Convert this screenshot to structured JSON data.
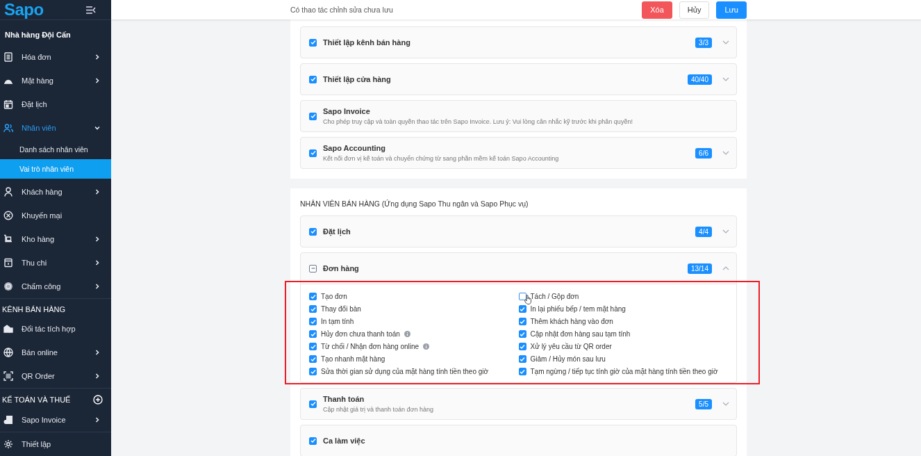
{
  "sidebar": {
    "logo": "Sapo",
    "store": "Nhà hàng Đội Cấn",
    "groups": [
      {
        "items": [
          {
            "label": "Hóa đơn",
            "submenu": true,
            "expanded": false,
            "selected": false
          },
          {
            "label": "Mặt hàng",
            "submenu": true,
            "expanded": false,
            "selected": false
          },
          {
            "label": "Đặt lịch",
            "submenu": false,
            "expanded": false,
            "selected": false
          },
          {
            "label": "Nhân viên",
            "submenu": true,
            "expanded": true,
            "selected": true,
            "children": [
              {
                "label": "Danh sách nhân viên",
                "selected": false
              },
              {
                "label": "Vai trò nhân viên",
                "selected": true
              }
            ]
          },
          {
            "label": "Khách hàng",
            "submenu": true,
            "expanded": false,
            "selected": false
          },
          {
            "label": "Khuyến mại",
            "submenu": false,
            "expanded": false,
            "selected": false
          },
          {
            "label": "Kho hàng",
            "submenu": true,
            "expanded": false,
            "selected": false
          },
          {
            "label": "Thu chi",
            "submenu": true,
            "expanded": false,
            "selected": false
          },
          {
            "label": "Chấm công",
            "submenu": true,
            "expanded": false,
            "selected": false
          }
        ]
      },
      {
        "title": "KÊNH BÁN HÀNG",
        "items": [
          {
            "label": "Đối tác tích hợp",
            "submenu": false,
            "expanded": false,
            "selected": false
          },
          {
            "label": "Bán online",
            "submenu": true,
            "expanded": false,
            "selected": false
          },
          {
            "label": "QR Order",
            "submenu": true,
            "expanded": false,
            "selected": false
          }
        ]
      },
      {
        "title": "KẾ TOÁN VÀ THUẾ",
        "add": true,
        "items": [
          {
            "label": "Sapo Invoice",
            "submenu": true,
            "expanded": false,
            "selected": false
          }
        ]
      },
      {
        "items": [
          {
            "label": "Thiết lập",
            "submenu": false,
            "expanded": false,
            "selected": false
          }
        ]
      }
    ]
  },
  "topbar": {
    "message": "Có thao tác chỉnh sửa chưa lưu",
    "buttons": [
      {
        "label": "Xóa",
        "kind": "danger"
      },
      {
        "label": "Hủy",
        "kind": "default"
      },
      {
        "label": "Lưu",
        "kind": "primary"
      }
    ]
  },
  "sections": [
    {
      "cards": [
        {
          "label": "Thiết lập kênh bán hàng",
          "checked": true,
          "indeterminate": false,
          "count": "3/3",
          "expanded": false
        },
        {
          "label": "Thiết lập cửa hàng",
          "checked": true,
          "indeterminate": false,
          "count": "40/40",
          "expanded": false
        },
        {
          "label": "Sapo Invoice",
          "checked": true,
          "indeterminate": false,
          "description": "Cho phép truy cập và toàn quyền thao tác trên Sapo Invoice. Lưu ý: Vui lòng cân nhắc kỹ trước khi phân quyền!",
          "expanded": false
        },
        {
          "label": "Sapo Accounting",
          "checked": true,
          "indeterminate": false,
          "description": "Kết nối đơn vị kế toán và chuyển chứng từ sang phần mềm kế toán Sapo Accounting",
          "count": "6/6",
          "expanded": false
        }
      ]
    },
    {
      "title": "NHÂN VIÊN BÁN HÀNG (Ứng dụng Sapo Thu ngân và Sapo Phục vụ)",
      "cards": [
        {
          "label": "Đặt lịch",
          "checked": true,
          "indeterminate": false,
          "count": "4/4",
          "expanded": false
        },
        {
          "label": "Đơn hàng",
          "checked": false,
          "indeterminate": true,
          "count": "13/14",
          "expanded": true,
          "highlighted": true,
          "permissions": [
            {
              "label": "Tạo đơn",
              "checked": true,
              "info": false,
              "hovered": false
            },
            {
              "label": "Tách / Gộp đơn",
              "checked": false,
              "info": false,
              "hovered": true
            },
            {
              "label": "Thay đổi bàn",
              "checked": true,
              "info": false,
              "hovered": false
            },
            {
              "label": "In lại phiếu bếp / tem mặt hàng",
              "checked": true,
              "info": false,
              "hovered": false
            },
            {
              "label": "In tạm tính",
              "checked": true,
              "info": false,
              "hovered": false
            },
            {
              "label": "Thêm khách hàng vào đơn",
              "checked": true,
              "info": false,
              "hovered": false
            },
            {
              "label": "Hủy đơn chưa thanh toán",
              "checked": true,
              "info": true,
              "hovered": false
            },
            {
              "label": "Cập nhật đơn hàng sau tạm tính",
              "checked": true,
              "info": false,
              "hovered": false
            },
            {
              "label": "Từ chối / Nhận đơn hàng online",
              "checked": true,
              "info": true,
              "hovered": false
            },
            {
              "label": "Xử lý yêu cầu từ QR order",
              "checked": true,
              "info": false,
              "hovered": false
            },
            {
              "label": "Tạo nhanh mặt hàng",
              "checked": true,
              "info": false,
              "hovered": false
            },
            {
              "label": "Giảm / Hủy món sau lưu",
              "checked": true,
              "info": false,
              "hovered": false
            },
            {
              "label": "Sửa thời gian sử dụng của mặt hàng tính tiền theo giờ",
              "checked": true,
              "info": false,
              "hovered": false
            },
            {
              "label": "Tạm ngừng / tiếp tục tính giờ của mặt hàng tính tiền theo giờ",
              "checked": true,
              "info": false,
              "hovered": false
            }
          ]
        },
        {
          "label": "Thanh toán",
          "checked": true,
          "indeterminate": false,
          "description": "Cập nhật giá trị và thanh toán đơn hàng",
          "count": "5/5",
          "expanded": false
        },
        {
          "label": "Ca làm việc",
          "checked": true,
          "indeterminate": false,
          "expanded": false
        }
      ]
    }
  ]
}
